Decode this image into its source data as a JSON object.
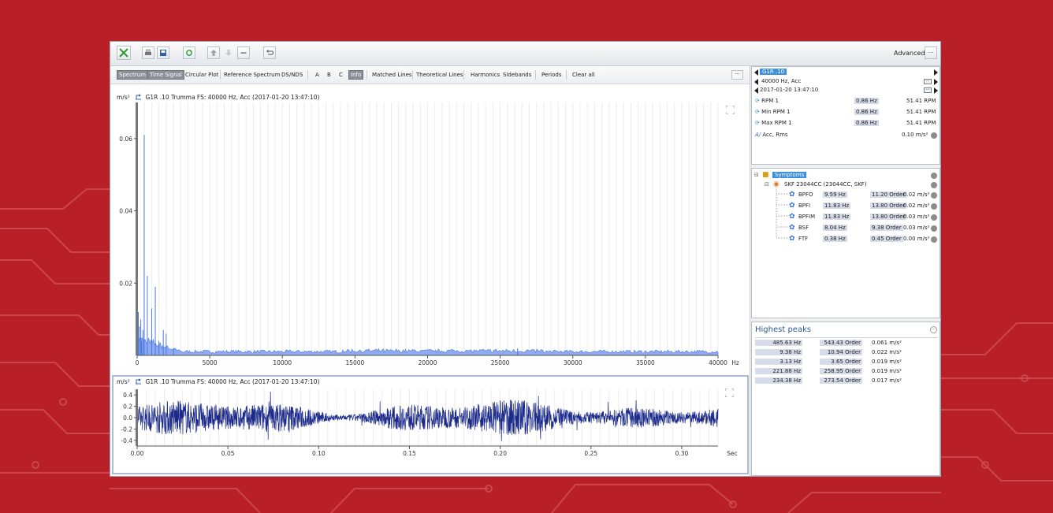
{
  "colors": {
    "background": "#b91f26",
    "circuit_line": "#d1545a",
    "spectrum_series": "#4a78e0",
    "signal_series": "#1b2a8a",
    "selection": "#3d8fe0"
  },
  "toolbar": {
    "buttons": [
      "close-x-icon",
      "print-icon",
      "save-icon",
      "refresh-icon",
      "move-up-icon",
      "move-down-icon",
      "more-icon",
      "undo-icon"
    ],
    "advanced_label": "Advanced",
    "more_label": "···"
  },
  "view_toolbar": {
    "buttons": [
      "Spectrum",
      "Time Signal",
      "Circular Plot",
      "Reference Spectrum",
      "DS/NDS",
      "A",
      "B",
      "C",
      "Info",
      "Matched Lines",
      "Theoretical Lines",
      "Harmonics",
      "Sidebands",
      "Periods",
      "Clear all"
    ],
    "active": [
      "Spectrum",
      "Time Signal",
      "Info"
    ],
    "more_label": "···"
  },
  "spectrum": {
    "unit": "m/s²",
    "header": "G1R   .10  Trumma FS: 40000 Hz, Acc (2017-01-20 13:47:10)"
  },
  "signal": {
    "unit": "m/s²",
    "header": "G1R   .10  Trumma FS: 40000 Hz, Acc (2017-01-20 13:47:10)"
  },
  "chart_data": [
    {
      "type": "bar",
      "xunit": "Hz",
      "xlim": [
        0,
        40000
      ],
      "ylim": [
        0,
        0.07
      ],
      "xticks": [
        0,
        5000,
        10000,
        15000,
        20000,
        25000,
        30000,
        35000,
        40000
      ],
      "xtick_labels": [
        "0",
        "5000",
        "10000",
        "15000",
        "20000",
        "25000",
        "30000",
        "35000",
        "40000"
      ],
      "yticks": [
        0.02,
        0.04,
        0.06
      ],
      "ytick_labels": [
        "0.02",
        "0.04",
        "0.06"
      ],
      "grid": true,
      "peaks_x": [
        80,
        160,
        250,
        300,
        400,
        485.63,
        700,
        1000,
        1250,
        1500,
        1800,
        2000,
        2500,
        26200
      ],
      "peaks_y": [
        0.012,
        0.008,
        0.01,
        0.004,
        0.007,
        0.061,
        0.022,
        0.013,
        0.019,
        0.004,
        0.007,
        0.006,
        0.002,
        0.002
      ]
    },
    {
      "type": "line",
      "xunit": "Sec",
      "xlim": [
        0,
        0.32
      ],
      "ylim": [
        -0.5,
        0.5
      ],
      "xticks": [
        0,
        0.05,
        0.1,
        0.15,
        0.2,
        0.25,
        0.3
      ],
      "xtick_labels": [
        "0.00",
        "0.05",
        "0.10",
        "0.15",
        "0.20",
        "0.25",
        "0.30"
      ],
      "yticks": [
        0.4,
        0.2,
        0.0,
        -0.2,
        -0.4
      ],
      "ytick_labels": [
        "0.4",
        "0.2",
        "0.0",
        "-0.2",
        "-0.4"
      ],
      "grid": true
    }
  ],
  "info": {
    "title": "G1R   .10",
    "line2": "40000 Hz, Acc",
    "line3": "2017-01-20 13:47:10",
    "rows": [
      {
        "label": "RPM 1",
        "hz": "0.86 Hz",
        "rpm": "51.41 RPM"
      },
      {
        "label": "Min RPM 1",
        "hz": "0.86 Hz",
        "rpm": "51.41 RPM"
      },
      {
        "label": "Max RPM 1",
        "hz": "0.86 Hz",
        "rpm": "51.41 RPM"
      }
    ],
    "rms_label": "Acc, Rms",
    "rms_value": "0.10 m/s²"
  },
  "symptoms": {
    "root_label": "Symptoms",
    "bearing_label": "SKF 23044CC (23044CC, SKF)",
    "items": [
      {
        "name": "BPFO",
        "hz": "9.59 Hz",
        "order": "11.20 Order",
        "value": "0.02 m/s²"
      },
      {
        "name": "BPFI",
        "hz": "11.83 Hz",
        "order": "13.80 Order",
        "value": "0.02 m/s²"
      },
      {
        "name": "BPFIM",
        "hz": "11.83 Hz",
        "order": "13.80 Order",
        "value": "0.03 m/s²"
      },
      {
        "name": "BSF",
        "hz": "8.04 Hz",
        "order": "9.38 Order",
        "value": "0.03 m/s²"
      },
      {
        "name": "FTF",
        "hz": "0.38 Hz",
        "order": "0.45 Order",
        "value": "0.00 m/s²"
      }
    ]
  },
  "peaks": {
    "title": "Highest peaks",
    "rows": [
      {
        "hz": "485.63 Hz",
        "order": "543.43 Order",
        "value": "0.061 m/s²"
      },
      {
        "hz": "9.38 Hz",
        "order": "10.94 Order",
        "value": "0.022 m/s²"
      },
      {
        "hz": "3.13 Hz",
        "order": "3.65 Order",
        "value": "0.019 m/s²"
      },
      {
        "hz": "221.88 Hz",
        "order": "258.95 Order",
        "value": "0.019 m/s²"
      },
      {
        "hz": "234.38 Hz",
        "order": "273.54 Order",
        "value": "0.017 m/s²"
      }
    ]
  }
}
